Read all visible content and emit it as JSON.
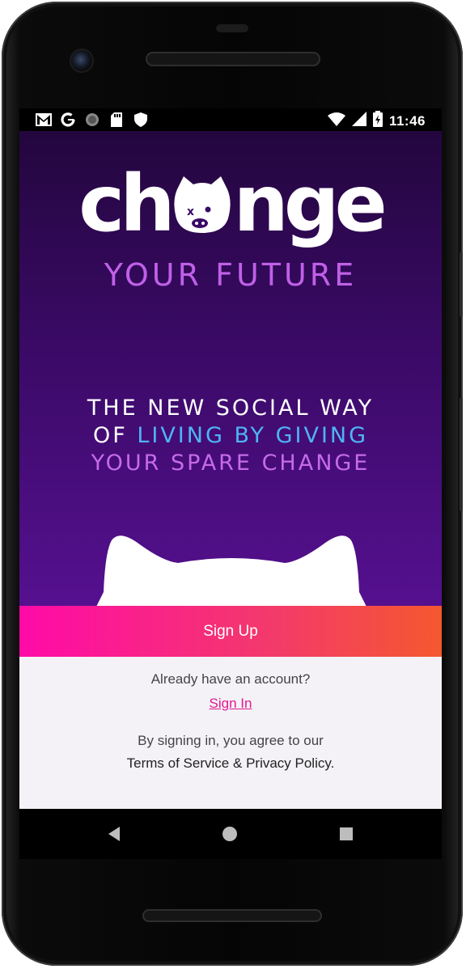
{
  "status_bar": {
    "time": "11:46",
    "left_icons": [
      "gmail-icon",
      "google-icon",
      "sync-icon",
      "sd-card-icon",
      "shield-icon"
    ],
    "right_icons": [
      "wifi-icon",
      "signal-icon",
      "battery-icon"
    ]
  },
  "logo": {
    "word_start": "ch",
    "word_end": "nge",
    "subtitle": "YOUR FUTURE"
  },
  "hero": {
    "line1": "THE NEW SOCIAL WAY",
    "line2_prefix": "OF ",
    "line2_highlight": "LIVING BY GIVING",
    "line3": "YOUR SPARE CHANGE"
  },
  "actions": {
    "signup_label": "Sign Up",
    "already_text": "Already have an account?",
    "signin_label": "Sign In",
    "agree_text": "By signing in, you agree to our",
    "terms_label": "Terms of Service",
    "amp": "&",
    "privacy_label": "Privacy Policy",
    "period": "."
  },
  "colors": {
    "hero_top": "#23063e",
    "hero_bottom": "#55108f",
    "subtitle": "#c060e8",
    "highlight": "#4fb4f4",
    "signup_start": "#ff0aa8",
    "signup_end": "#f5582e",
    "link": "#e4178f"
  },
  "nav_bar": {
    "icons": [
      "back-icon",
      "home-icon",
      "recents-icon"
    ]
  }
}
